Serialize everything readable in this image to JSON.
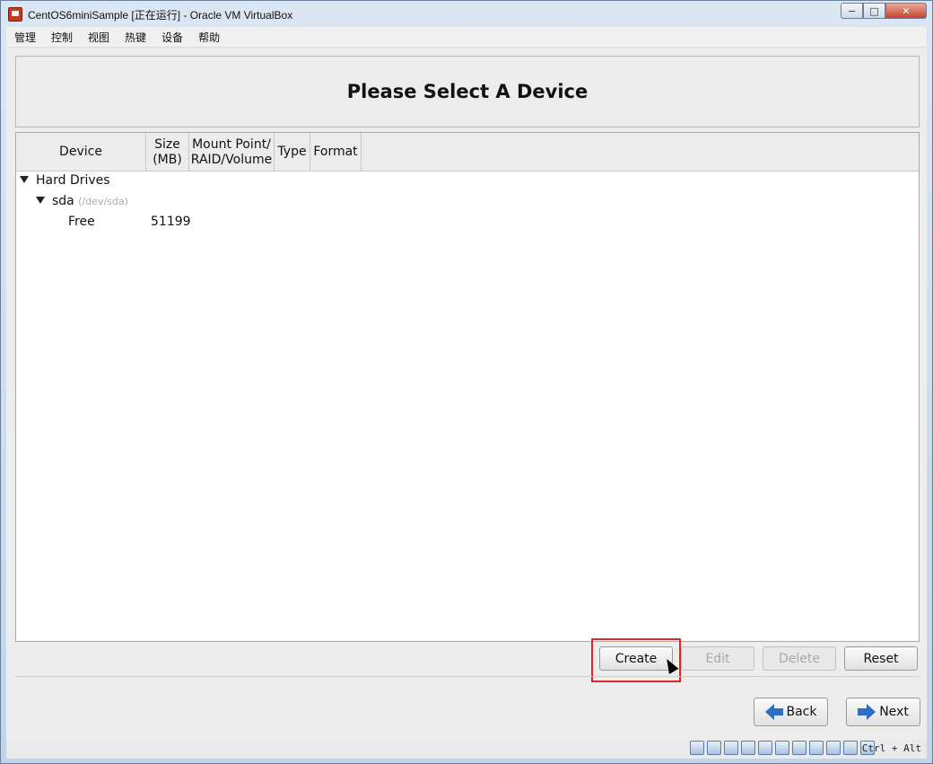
{
  "window": {
    "title": "CentOS6miniSample [正在运行] - Oracle VM VirtualBox",
    "minimize": "−",
    "maximize": "□",
    "close": "✕"
  },
  "menu": [
    "管理",
    "控制",
    "视图",
    "热键",
    "设备",
    "帮助"
  ],
  "header": {
    "title": "Please Select A Device"
  },
  "columns": {
    "device": "Device",
    "size_line1": "Size",
    "size_line2": "(MB)",
    "mount_line1": "Mount Point/",
    "mount_line2": "RAID/Volume",
    "type": "Type",
    "format": "Format"
  },
  "tree": {
    "hard_drives": "Hard Drives",
    "sda": "sda",
    "sda_path": "(/dev/sda)",
    "free_label": "Free",
    "free_size": "51199"
  },
  "actions": {
    "create": "Create",
    "edit": "Edit",
    "delete": "Delete",
    "reset": "Reset"
  },
  "nav": {
    "back": "Back",
    "next": "Next"
  },
  "statusbar": {
    "host_key": "Ctrl + Alt",
    "icons": [
      "hard-disk-icon",
      "optical-drive-icon",
      "audio-icon",
      "network-icon",
      "usb-icon",
      "shared-folder-icon",
      "display-icon",
      "video-capture-icon",
      "cpu-icon",
      "mouse-integration-icon",
      "host-key-icon"
    ]
  },
  "colors": {
    "highlight": "#e0242a",
    "arrow": "#2f6fc2"
  }
}
